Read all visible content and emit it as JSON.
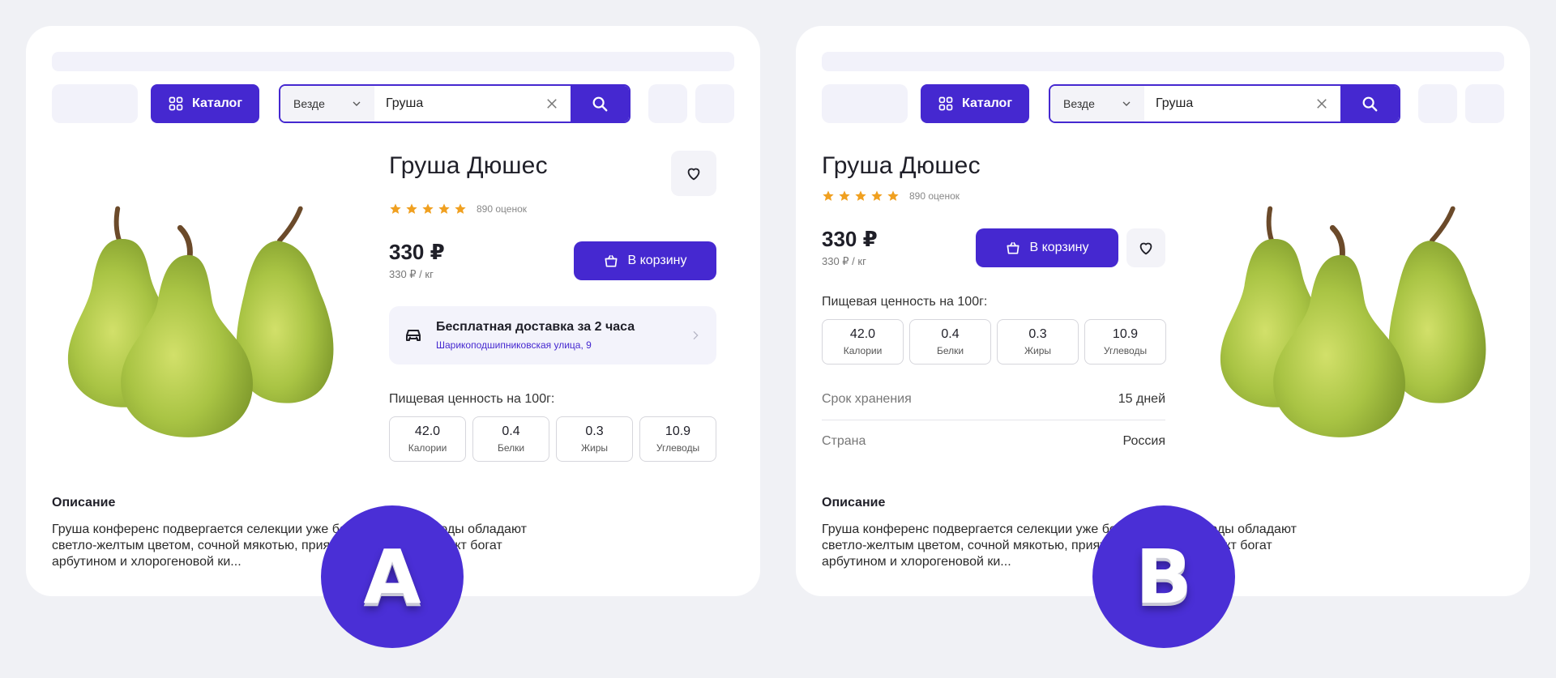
{
  "colors": {
    "accent": "#4528d0",
    "star": "#f0a020",
    "background": "#f0f1f5",
    "badge": "#4a2fd6"
  },
  "header": {
    "catalog_label": "Каталог",
    "search_scope": "Везде",
    "search_query": "Груша",
    "icons": {
      "catalog": "grid-icon",
      "scope": "chevron-down-icon",
      "clear": "close-icon",
      "search": "search-icon"
    }
  },
  "product": {
    "title": "Груша Дюшес",
    "rating_stars": 5,
    "rating_count": "890 оценок",
    "price": "330 ₽",
    "price_per_kg": "330 ₽ / кг",
    "cart_label": "В корзину",
    "delivery_title": "Бесплатная доставка за 2 часа",
    "delivery_address": "Шарикоподшипниковская улица, 9",
    "nutrition_title": "Пищевая ценность на 100г:",
    "nutrition": [
      {
        "value": "42.0",
        "label": "Калории"
      },
      {
        "value": "0.4",
        "label": "Белки"
      },
      {
        "value": "0.3",
        "label": "Жиры"
      },
      {
        "value": "10.9",
        "label": "Углеводы"
      }
    ],
    "specs": [
      {
        "key": "Срок хранения",
        "value": "15 дней"
      },
      {
        "key": "Страна",
        "value": "Россия"
      }
    ],
    "description_title": "Описание",
    "description_a": "Груша конференс подвергается селекции уже более 130 лет. Плоды обладают светло-желтым цветом, сочной мякотью, приятным ароматом. Фрукт богат арбутином и хлорогеновой ки...",
    "description_b": "Груша конференс подвергается селекции уже более 130 лет. Плоды обладают светло-желтым цветом, сочной мякотью, приятным ароматом. Фрукт богат арбутином и хлорогеновой ки..."
  },
  "variants": {
    "a": "A",
    "b": "B"
  }
}
